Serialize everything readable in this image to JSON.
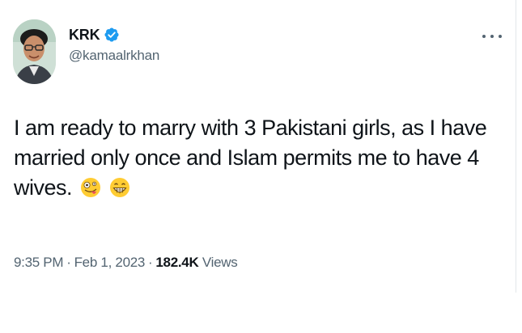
{
  "tweet": {
    "display_name": "KRK",
    "handle": "@kamaalrkhan",
    "text": "I am ready to marry with 3 Pakistani girls, as I have married only once and Islam permits me to have 4 wives.",
    "emojis": [
      "zany-face-emoji",
      "grinning-face-emoji"
    ],
    "time": "9:35 PM",
    "date": "Feb 1, 2023",
    "separator": "·",
    "views_count": "182.4K",
    "views_label": "Views",
    "verified": true
  },
  "colors": {
    "verified_badge": "#1d9bf0",
    "text_primary": "#0f1419",
    "text_secondary": "#536471"
  },
  "icons": {
    "more": "more-options-icon",
    "verified": "verified-badge-icon"
  }
}
